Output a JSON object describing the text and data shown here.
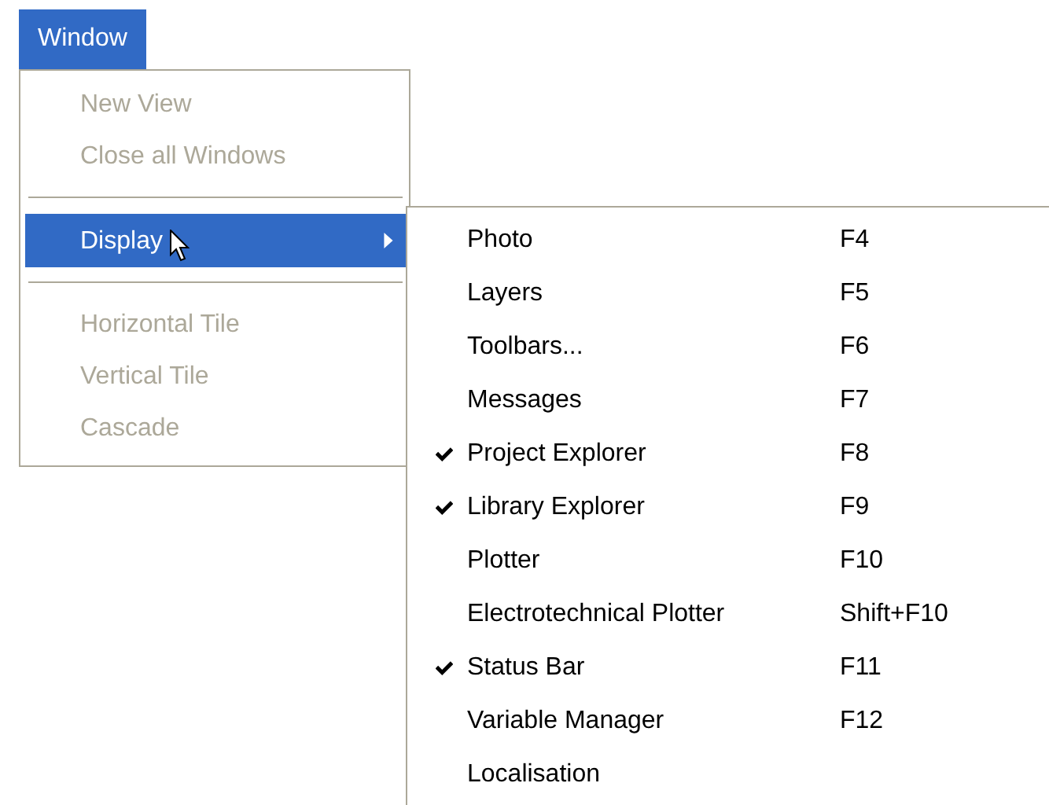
{
  "menu_bar": [
    {
      "label": "Window",
      "selected": true
    }
  ],
  "menu": {
    "items": [
      {
        "kind": "item",
        "label": "New View",
        "disabled": true
      },
      {
        "kind": "item",
        "label": "Close all Windows",
        "disabled": true
      },
      {
        "kind": "separator"
      },
      {
        "kind": "submenu",
        "label": "Display",
        "selected": true
      },
      {
        "kind": "separator"
      },
      {
        "kind": "item",
        "label": "Horizontal Tile",
        "disabled": true
      },
      {
        "kind": "item",
        "label": "Vertical Tile",
        "disabled": true
      },
      {
        "kind": "item",
        "label": "Cascade",
        "disabled": true
      }
    ]
  },
  "submenu": {
    "items": [
      {
        "label": "Photo",
        "shortcut": "F4",
        "checked": false
      },
      {
        "label": "Layers",
        "shortcut": "F5",
        "checked": false
      },
      {
        "label": "Toolbars...",
        "shortcut": "F6",
        "checked": false
      },
      {
        "label": "Messages",
        "shortcut": "F7",
        "checked": false
      },
      {
        "label": "Project Explorer",
        "shortcut": "F8",
        "checked": true
      },
      {
        "label": "Library Explorer",
        "shortcut": "F9",
        "checked": true
      },
      {
        "label": "Plotter",
        "shortcut": "F10",
        "checked": false
      },
      {
        "label": "Electrotechnical Plotter",
        "shortcut": "Shift+F10",
        "checked": false
      },
      {
        "label": "Status Bar",
        "shortcut": "F11",
        "checked": true
      },
      {
        "label": "Variable Manager",
        "shortcut": "F12",
        "checked": false
      },
      {
        "label": "Localisation",
        "checked": false
      }
    ]
  }
}
